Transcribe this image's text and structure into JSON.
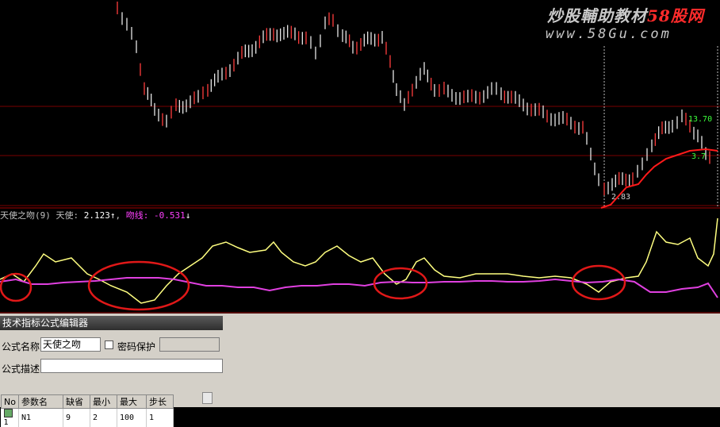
{
  "watermark": {
    "line1_prefix": "炒股輔助教材",
    "line1_accent": "58股网",
    "line2": "www.58Gu.com"
  },
  "price_chart": {
    "label_high": "13.70",
    "label_mid": "3.7",
    "label_low": "2.83",
    "colors": {
      "up": "#ff3c3c",
      "down": "#e8e8e8",
      "ma": "#ff1a1a",
      "grid": "#7a0000",
      "label_green": "#3cff3c"
    }
  },
  "indicator": {
    "name": "天使之吻(9)",
    "line1_label": "天使: ",
    "line1_value": "2.123",
    "line1_arrow": "↑",
    "line2_label": "吻线: ",
    "line2_value": "-0.531",
    "line2_arrow": "↓",
    "colors": {
      "line1": "#ffff80",
      "line2": "#e040e0",
      "circle": "#e01818"
    }
  },
  "editor": {
    "title": "技术指标公式编辑器",
    "name_label": "公式名称",
    "name_value": "天使之吻",
    "password_label": "密码保护",
    "desc_label": "公式描述",
    "desc_value": "",
    "param_table": {
      "columns": [
        "No",
        "参数名",
        "缺省",
        "最小",
        "最大",
        "步长"
      ],
      "rows": [
        [
          "1",
          "N1",
          "9",
          "2",
          "100",
          "1"
        ]
      ]
    }
  }
}
